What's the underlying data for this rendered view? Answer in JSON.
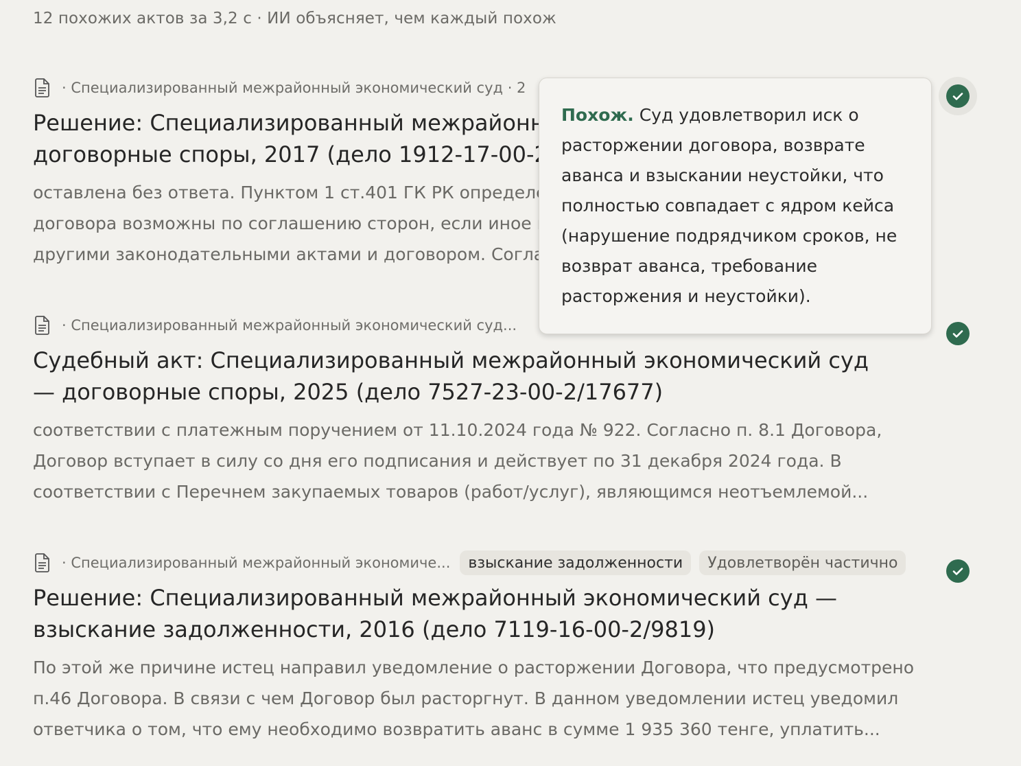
{
  "summary": "12 похожих актов за 3,2 с · ИИ объясняет, чем каждый похож",
  "tooltip": {
    "lead": "Похож.",
    "text": " Суд удовлетворил иск о расторжении договора, возврате аванса и взыскании неустойки, что полностью совпадает с ядром кейса (нарушение подрядчиком сроков, не возврат аванса, требование расторжения и неустойки)."
  },
  "results": [
    {
      "meta": "· Специализированный межрайонный экономический суд · 2",
      "tags": [
        "",
        ""
      ],
      "title": "Решение: Специализированный межрайонный экономический суд — договорные споры, 2017 (дело 1912-17-00-2/3",
      "excerpt": "оставлена без ответа. Пунктом 1 ст.401 ГК РК определено, что изменение и расторжение договора возможны по соглашению сторон, если иное не предусмотрено настоящим Кодексом, другими законодательными актами и договором. Согла"
    },
    {
      "meta": "· Специализированный межрайонный экономический суд...",
      "tags": [
        "",
        ""
      ],
      "title": "Судебный акт: Специализированный межрайонный экономический суд — договорные споры, 2025 (дело 7527-23-00-2/17677)",
      "excerpt": "соответствии с платежным поручением от 11.10.2024 года № 922. Согласно п. 8.1 Договора, Договор вступает в силу со дня его подписания и действует по 31 декабря 2024 года. В соответствии с Перечнем закупаемых товаров (работ/услуг), являющимся неотъемлемой..."
    },
    {
      "meta": "· Специализированный межрайонный экономиче...",
      "tags": [
        "взыскание задолженности",
        "Удовлетворён частично"
      ],
      "title": "Решение: Специализированный межрайонный экономический суд — взыскание задолженности, 2016 (дело 7119-16-00-2/9819)",
      "excerpt": "По этой же причине истец направил уведомление о расторжении Договора, что предусмотрено п.46 Договора. В связи с чем Договор был расторгнут. В данном уведомлении истец уведомил ответчика о том, что ему необходимо возвратить аванс в сумме 1 935 360 тенге, уплатить..."
    }
  ],
  "icons": {
    "document": "document-icon",
    "check": "check-circle-icon"
  },
  "colors": {
    "background": "#f2f1ed",
    "accent": "#2f6b4f"
  }
}
